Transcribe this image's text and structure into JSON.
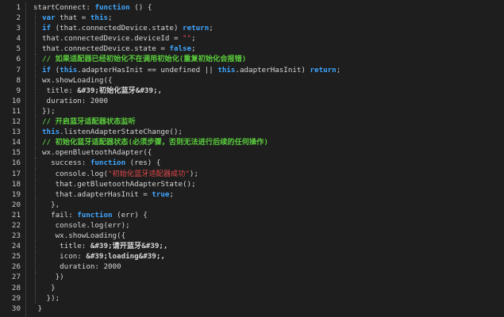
{
  "editor": {
    "lines": [
      {
        "num": "1",
        "indent": 0,
        "tokens": [
          [
            "pl",
            "startConnect: "
          ],
          [
            "kw",
            "function"
          ],
          [
            "pl",
            " () {"
          ]
        ]
      },
      {
        "num": "2",
        "indent": 1,
        "tokens": [
          [
            "kw",
            "var"
          ],
          [
            "pl",
            " that = "
          ],
          [
            "kw",
            "this"
          ],
          [
            "pl",
            ";"
          ]
        ]
      },
      {
        "num": "3",
        "indent": 1,
        "tokens": [
          [
            "kw",
            "if"
          ],
          [
            "pl",
            " (that.connectedDevice.state) "
          ],
          [
            "kw",
            "return"
          ],
          [
            "pl",
            ";"
          ]
        ]
      },
      {
        "num": "4",
        "indent": 1,
        "tokens": [
          [
            "pl",
            "that.connectedDevice.deviceId = "
          ],
          [
            "str",
            "\"\""
          ],
          [
            "pl",
            ";"
          ]
        ]
      },
      {
        "num": "5",
        "indent": 1,
        "tokens": [
          [
            "pl",
            "that.connectedDevice.state = "
          ],
          [
            "kw",
            "false"
          ],
          [
            "pl",
            ";"
          ]
        ]
      },
      {
        "num": "6",
        "indent": 1,
        "tokens": [
          [
            "cm",
            "// 如果适配器已经初始化不在调用初始化(重复初始化会报错)"
          ]
        ]
      },
      {
        "num": "7",
        "indent": 1,
        "tokens": [
          [
            "kw",
            "if"
          ],
          [
            "pl",
            " ("
          ],
          [
            "kw",
            "this"
          ],
          [
            "pl",
            ".adapterHasInit == undefined || "
          ],
          [
            "kw",
            "this"
          ],
          [
            "pl",
            ".adapterHasInit) "
          ],
          [
            "kw",
            "return"
          ],
          [
            "pl",
            ";"
          ]
        ]
      },
      {
        "num": "8",
        "indent": 1,
        "tokens": [
          [
            "pl",
            "wx.showLoading({"
          ]
        ]
      },
      {
        "num": "9",
        "indent": 1,
        "tokens": [
          [
            "pl",
            " title: "
          ],
          [
            "ent",
            "&#39;初始化蓝牙&#39;,"
          ]
        ]
      },
      {
        "num": "10",
        "indent": 1,
        "tokens": [
          [
            "pl",
            " duration: 2000"
          ]
        ]
      },
      {
        "num": "11",
        "indent": 1,
        "tokens": [
          [
            "pl",
            "});"
          ]
        ]
      },
      {
        "num": "12",
        "indent": 1,
        "tokens": [
          [
            "cm",
            "// 开启蓝牙适配器状态监听"
          ]
        ]
      },
      {
        "num": "13",
        "indent": 1,
        "tokens": [
          [
            "kw",
            "this"
          ],
          [
            "pl",
            ".listenAdapterStateChange();"
          ]
        ]
      },
      {
        "num": "14",
        "indent": 1,
        "tokens": [
          [
            "cm",
            "// 初始化蓝牙适配器状态(必须步骤，否则无法进行后续的任何操作)"
          ]
        ]
      },
      {
        "num": "15",
        "indent": 1,
        "tokens": [
          [
            "pl",
            "wx.openBluetoothAdapter({"
          ]
        ]
      },
      {
        "num": "16",
        "indent": 1,
        "tokens": [
          [
            "pl",
            "  success: "
          ],
          [
            "kw",
            "function"
          ],
          [
            "pl",
            " (res) {"
          ]
        ]
      },
      {
        "num": "17",
        "indent": 1,
        "tokens": [
          [
            "pl",
            "   console.log("
          ],
          [
            "str",
            "\"初始化蓝牙适配器成功\""
          ],
          [
            "pl",
            ");"
          ]
        ]
      },
      {
        "num": "18",
        "indent": 1,
        "tokens": [
          [
            "pl",
            "   that.getBluetoothAdapterState();"
          ]
        ]
      },
      {
        "num": "19",
        "indent": 1,
        "tokens": [
          [
            "pl",
            "   that.adapterHasInit = "
          ],
          [
            "kw",
            "true"
          ],
          [
            "pl",
            ";"
          ]
        ]
      },
      {
        "num": "20",
        "indent": 1,
        "tokens": [
          [
            "pl",
            "  },"
          ]
        ]
      },
      {
        "num": "21",
        "indent": 1,
        "tokens": [
          [
            "pl",
            "  fail: "
          ],
          [
            "kw",
            "function"
          ],
          [
            "pl",
            " (err) {"
          ]
        ]
      },
      {
        "num": "22",
        "indent": 1,
        "tokens": [
          [
            "pl",
            "   console.log(err);"
          ]
        ]
      },
      {
        "num": "23",
        "indent": 1,
        "tokens": [
          [
            "pl",
            "   wx.showLoading({"
          ]
        ]
      },
      {
        "num": "24",
        "indent": 1,
        "tokens": [
          [
            "pl",
            "    title: "
          ],
          [
            "ent",
            "&#39;请开蓝牙&#39;,"
          ]
        ]
      },
      {
        "num": "25",
        "indent": 1,
        "tokens": [
          [
            "pl",
            "    icon: "
          ],
          [
            "ent",
            "&#39;loading&#39;,"
          ]
        ]
      },
      {
        "num": "26",
        "indent": 1,
        "tokens": [
          [
            "pl",
            "    duration: 2000"
          ]
        ]
      },
      {
        "num": "27",
        "indent": 1,
        "tokens": [
          [
            "pl",
            "   })"
          ]
        ]
      },
      {
        "num": "28",
        "indent": 1,
        "tokens": [
          [
            "pl",
            "  }"
          ]
        ]
      },
      {
        "num": "29",
        "indent": 1,
        "tokens": [
          [
            "pl",
            " });"
          ]
        ]
      },
      {
        "num": "30",
        "indent": 0,
        "tokens": [
          [
            "pl",
            " }"
          ]
        ]
      }
    ]
  },
  "colors": {
    "background": "#1e1e1e",
    "keyword": "#3fa6ff",
    "string": "#e0484a",
    "comment": "#58c93b",
    "text": "#d6d6d6",
    "line_number": "#c8c8c8"
  }
}
